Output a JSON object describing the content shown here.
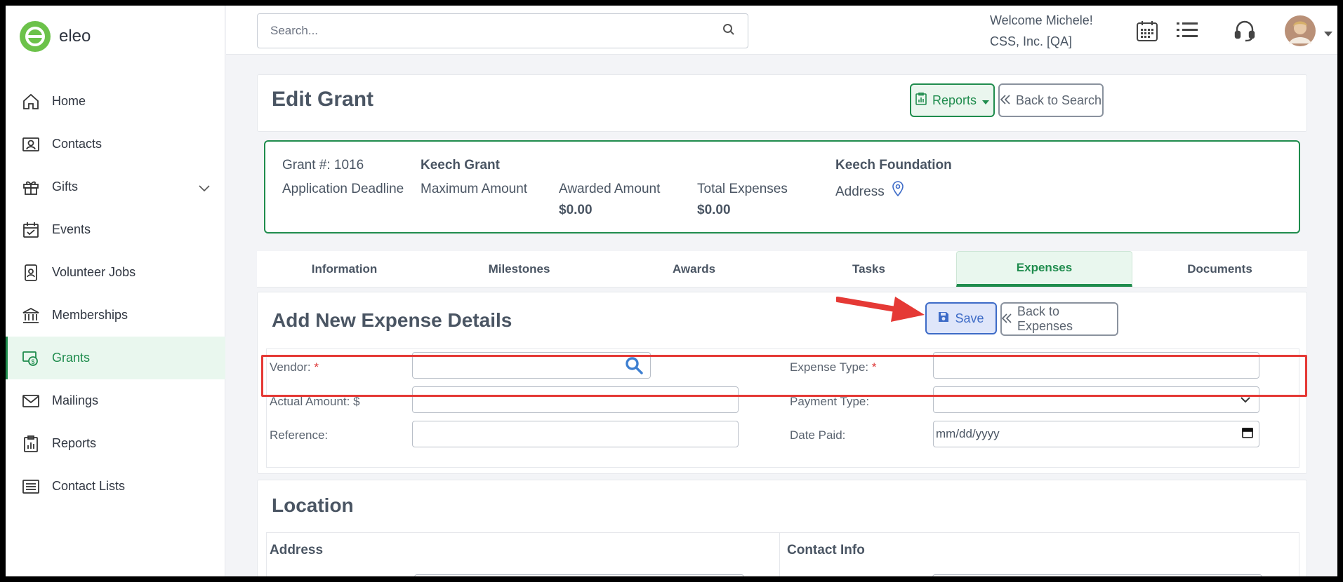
{
  "app": {
    "name": "eleo"
  },
  "colors": {
    "brand": "#6cc24a",
    "accent": "#1f8c4d",
    "save": "#3d6bc7",
    "highlight": "#e53935"
  },
  "sidebar": {
    "items": [
      {
        "label": "Home",
        "icon": "home-icon"
      },
      {
        "label": "Contacts",
        "icon": "contact-card-icon"
      },
      {
        "label": "Gifts",
        "icon": "gift-icon"
      },
      {
        "label": "Events",
        "icon": "calendar-check-icon"
      },
      {
        "label": "Volunteer Jobs",
        "icon": "badge-icon"
      },
      {
        "label": "Memberships",
        "icon": "institution-icon"
      },
      {
        "label": "Grants",
        "icon": "grants-icon"
      },
      {
        "label": "Mailings",
        "icon": "envelope-icon"
      },
      {
        "label": "Reports",
        "icon": "report-icon"
      },
      {
        "label": "Contact Lists",
        "icon": "list-icon"
      }
    ]
  },
  "header": {
    "search_placeholder": "Search...",
    "welcome": "Welcome Michele!",
    "org": "CSS, Inc. [QA]"
  },
  "page": {
    "title": "Edit Grant",
    "reports_label": "Reports",
    "back_to_search_label": "Back to Search"
  },
  "summary": {
    "grant_number": "Grant #: 1016",
    "application_deadline": "Application Deadline",
    "grant_name": "Keech Grant",
    "maximum_amount": "Maximum Amount",
    "awarded_label": "Awarded Amount",
    "awarded_value": "$0.00",
    "expenses_label": "Total Expenses",
    "expenses_value": "$0.00",
    "foundation": "Keech Foundation",
    "address": "Address"
  },
  "tabs": [
    {
      "label": "Information"
    },
    {
      "label": "Milestones"
    },
    {
      "label": "Awards"
    },
    {
      "label": "Tasks"
    },
    {
      "label": "Expenses",
      "active": true
    },
    {
      "label": "Documents"
    }
  ],
  "expense": {
    "title": "Add New Expense Details",
    "save_label": "Save",
    "back_label": "Back to Expenses",
    "vendor_label": "Vendor:",
    "required_mark": "*",
    "expense_type_label": "Expense Type:",
    "actual_amount_label": "Actual Amount: $",
    "payment_type_label": "Payment Type:",
    "reference_label": "Reference:",
    "date_paid_label": "Date Paid:",
    "date_placeholder": "mm/dd/yyyy"
  },
  "location": {
    "title": "Location",
    "address_title": "Address",
    "contact_title": "Contact Info"
  }
}
